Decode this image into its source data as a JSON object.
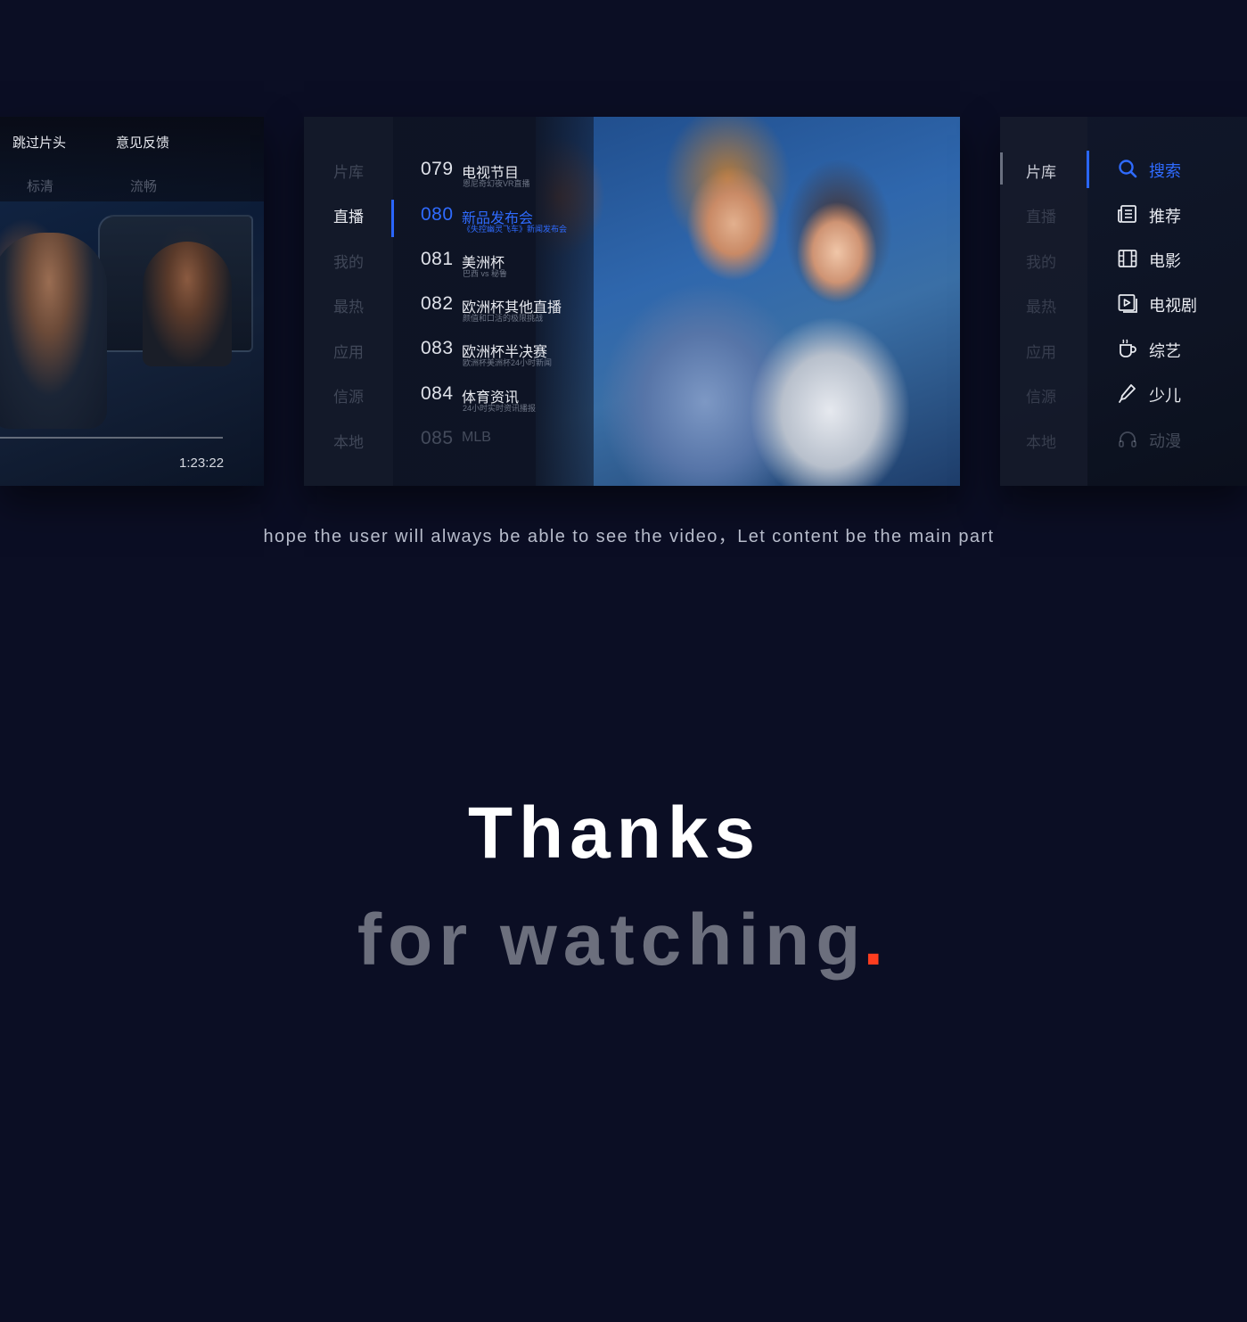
{
  "player": {
    "menu_skip": "跳过片头",
    "menu_feedback": "意见反馈",
    "quality_sd": "标清",
    "quality_smooth": "流畅",
    "time": "1:23:22"
  },
  "live": {
    "categories": [
      {
        "label": "片库",
        "active": false
      },
      {
        "label": "直播",
        "active": true
      },
      {
        "label": "我的",
        "active": false
      },
      {
        "label": "最热",
        "active": false
      },
      {
        "label": "应用",
        "active": false
      },
      {
        "label": "信源",
        "active": false
      },
      {
        "label": "本地",
        "active": false
      }
    ],
    "channels": [
      {
        "num": "079",
        "name": "电视节目",
        "sub": "恩尼奇幻夜VR直播",
        "active": false
      },
      {
        "num": "080",
        "name": "新品发布会",
        "sub": "《失控幽灵飞车》新闻发布会",
        "active": true
      },
      {
        "num": "081",
        "name": "美洲杯",
        "sub": "巴西 vs 秘鲁",
        "active": false
      },
      {
        "num": "082",
        "name": "欧洲杯其他直播",
        "sub": "颜值和口活的极限挑战",
        "active": false
      },
      {
        "num": "083",
        "name": "欧洲杯半决赛",
        "sub": "欧洲杯美洲杯24小时新闻",
        "active": false
      },
      {
        "num": "084",
        "name": "体育资讯",
        "sub": "24小时实时资讯播报",
        "active": false
      },
      {
        "num": "085",
        "name": "MLB",
        "sub": "",
        "active": false
      }
    ]
  },
  "library": {
    "categories": [
      {
        "label": "片库"
      },
      {
        "label": "直播"
      },
      {
        "label": "我的"
      },
      {
        "label": "最热"
      },
      {
        "label": "应用"
      },
      {
        "label": "信源"
      },
      {
        "label": "本地"
      }
    ],
    "items": [
      {
        "label": "搜索",
        "icon": "search-icon"
      },
      {
        "label": "推荐",
        "icon": "news-icon"
      },
      {
        "label": "电影",
        "icon": "film-icon"
      },
      {
        "label": "电视剧",
        "icon": "tv-play-icon"
      },
      {
        "label": "综艺",
        "icon": "cup-icon"
      },
      {
        "label": "少儿",
        "icon": "pencil-icon"
      },
      {
        "label": "动漫",
        "icon": "headphones-icon"
      }
    ]
  },
  "caption": "hope the user will always be able to see the video，Let content be the main part",
  "thanks": {
    "line1": "Thanks",
    "line2": "for watching",
    "dot": "."
  },
  "colors": {
    "background": "#0b0e24",
    "accent": "#2f6bff",
    "dot": "#ff3d1f"
  }
}
